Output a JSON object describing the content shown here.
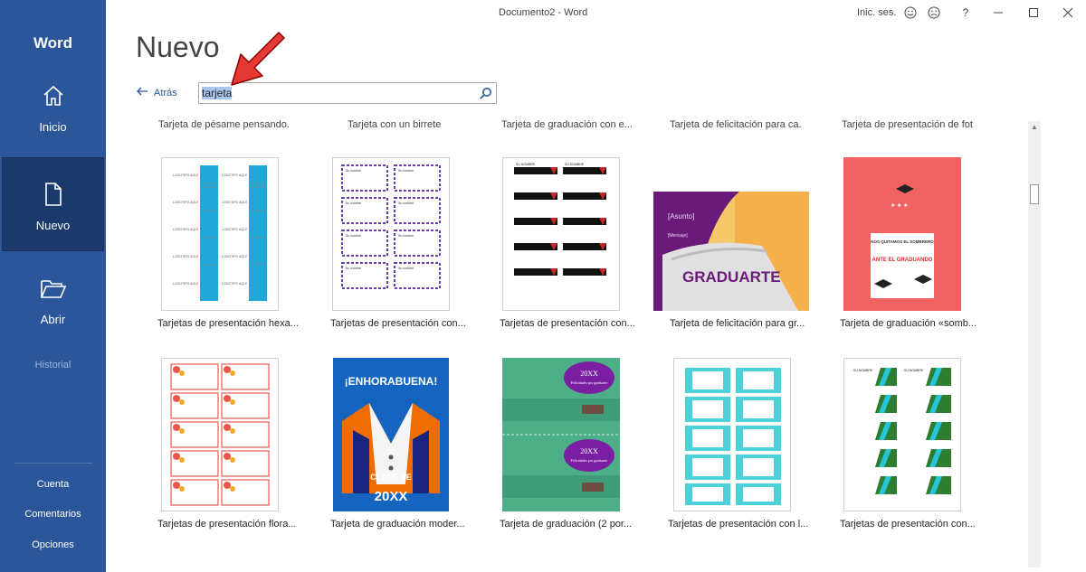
{
  "window": {
    "title": "Documento2 - Word",
    "signin": "Inic. ses.",
    "help": "?"
  },
  "sidebar": {
    "app_name": "Word",
    "items": [
      {
        "label": "Inicio"
      },
      {
        "label": "Nuevo"
      },
      {
        "label": "Abrir"
      }
    ],
    "history": "Historial",
    "bottom": [
      {
        "label": "Cuenta"
      },
      {
        "label": "Comentarios"
      },
      {
        "label": "Opciones"
      }
    ]
  },
  "main": {
    "title": "Nuevo",
    "back_label": "Atrás",
    "search": {
      "value": "tarjeta"
    }
  },
  "gallery": {
    "top_labels": [
      "Tarjeta de pésame pensando...",
      "Tarjeta con un birrete",
      "Tarjeta de graduación con e...",
      "Tarjeta de felicitación para ca...",
      "Tarjeta de presentación de foto"
    ],
    "row1": [
      "Tarjetas de presentación hexa...",
      "Tarjetas de presentación con...",
      "Tarjetas de presentación con...",
      "Tarjeta de felicitación para gr...",
      "Tarjeta de graduación «somb..."
    ],
    "row2": [
      "Tarjetas de presentación flora...",
      "Tarjeta de graduación moder...",
      "Tarjeta de graduación (2 por...",
      "Tarjetas de presentación con l...",
      "Tarjetas de presentación con..."
    ],
    "thumb_text": {
      "logo": "LOGOTIPO AQUÍ",
      "name": "Su nombre",
      "name_caps": "SU NOMBRE",
      "asunto": "[Asunto]",
      "msg": "[Mensaje]",
      "graduarte": "GRADUARTE",
      "sombrero1": "NOS QUITAMOS EL SOMBRERO",
      "sombrero2": "ANTE EL GRADUANDO",
      "enhorabuena": "¡ENHORABUENA!",
      "clase": "CLASE DE",
      "year": "20XX",
      "feli1": "20XX",
      "feli2": "Felicidades por graduarte"
    }
  },
  "colors": {
    "brand": "#2b579a",
    "selected": "#1b3a6b"
  }
}
